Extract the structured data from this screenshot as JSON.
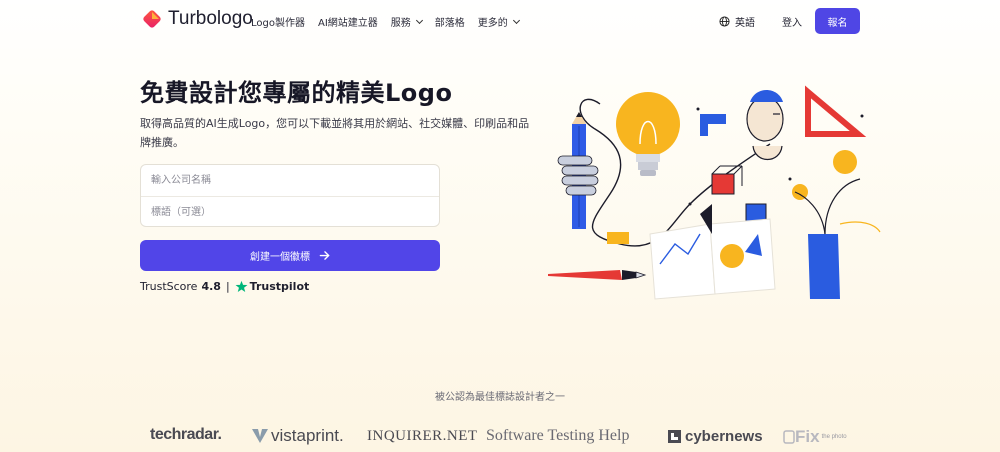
{
  "header": {
    "logo_text": "Turbologo",
    "nav": [
      {
        "label": "Logo製作器",
        "dropdown": false
      },
      {
        "label": "AI網站建立器",
        "dropdown": false
      },
      {
        "label": "服務",
        "dropdown": true
      },
      {
        "label": "部落格",
        "dropdown": false
      },
      {
        "label": "更多的",
        "dropdown": true
      }
    ],
    "language": "英語",
    "login": "登入",
    "signup": "報名"
  },
  "hero": {
    "title": "免費設計您專屬的精美Logo",
    "subtitle": "取得高品質的AI生成Logo，您可以下載並將其用於網站、社交媒體、印刷品和品牌推廣。",
    "company_placeholder": "輸入公司名稱",
    "company_value": "",
    "slogan_placeholder": "標語（可選）",
    "slogan_value": "",
    "cta": "創建一個徽標",
    "trust_label": "TrustScore",
    "trust_score": "4.8",
    "trust_separator": "|",
    "trustpilot": "Trustpilot"
  },
  "featured": {
    "heading": "被公認為最佳標誌設計者之一",
    "brands": {
      "techradar": "techradar.",
      "vistaprint": "vistaprint.",
      "inquirer": "INQUIRER.NET",
      "sth": "Software Testing Help",
      "cybernews": "cybernews",
      "fix": "Fix",
      "fix_small": "the photo"
    }
  },
  "icons": [
    "logo-mark-icon",
    "chevron-down-icon",
    "globe-icon",
    "arrow-right-icon",
    "trustpilot-star-icon",
    "vistaprint-icon",
    "cybernews-icon",
    "fixthephoto-icon"
  ],
  "colors": {
    "accent": "#4f46e5",
    "cta": "#5145e8",
    "trustpilot": "#00b67a"
  }
}
